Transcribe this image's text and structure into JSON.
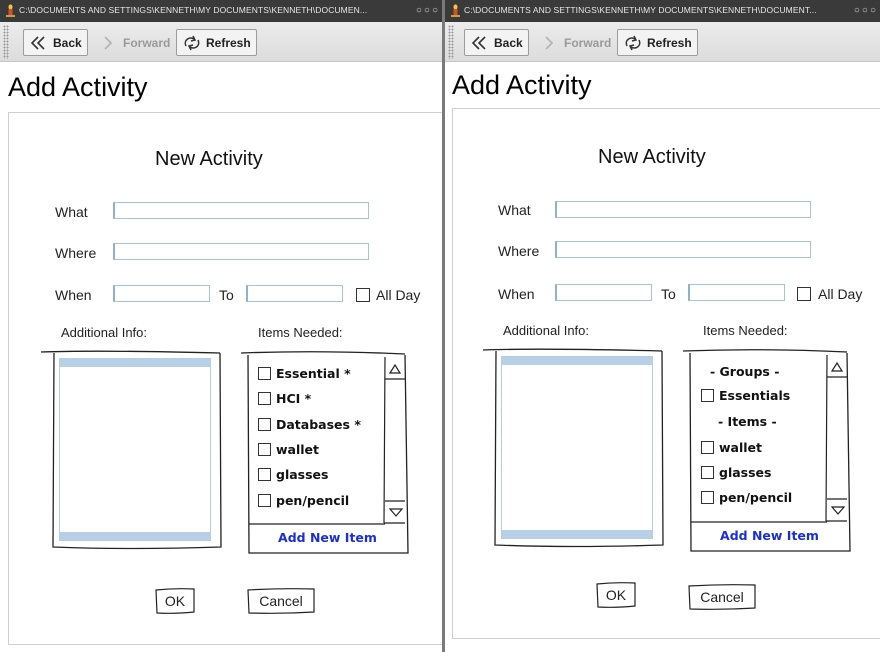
{
  "left": {
    "window_title": "C:\\DOCUMENTS AND SETTINGS\\KENNETH\\MY DOCUMENTS\\KENNETH\\DOCUMEN...",
    "toolbar": {
      "back_label": "Back",
      "forward_label": "Forward",
      "refresh_label": "Refresh"
    },
    "page_title": "Add Activity",
    "form": {
      "title": "New Activity",
      "what_label": "What",
      "what_value": "",
      "where_label": "Where",
      "where_value": "",
      "when_label": "When",
      "when_value": "",
      "to_label": "To",
      "to_value": "",
      "all_day_label": "All Day",
      "all_day_checked": false,
      "additional_info_label": "Additional Info:",
      "items_needed_label": "Items Needed:",
      "items": [
        {
          "label": "Essential *",
          "checked": false
        },
        {
          "label": "HCI *",
          "checked": false
        },
        {
          "label": "Databases *",
          "checked": false
        },
        {
          "label": "wallet",
          "checked": false
        },
        {
          "label": "glasses",
          "checked": false
        },
        {
          "label": "pen/pencil",
          "checked": false
        }
      ],
      "add_new_item_label": "Add New Item",
      "ok_label": "OK",
      "cancel_label": "Cancel"
    }
  },
  "right": {
    "window_title": "C:\\DOCUMENTS AND SETTINGS\\KENNETH\\MY DOCUMENTS\\KENNETH\\DOCUMENT...",
    "toolbar": {
      "back_label": "Back",
      "forward_label": "Forward",
      "refresh_label": "Refresh"
    },
    "page_title": "Add Activity",
    "form": {
      "title": "New Activity",
      "what_label": "What",
      "what_value": "",
      "where_label": "Where",
      "where_value": "",
      "when_label": "When",
      "when_value": "",
      "to_label": "To",
      "to_value": "",
      "all_day_label": "All Day",
      "all_day_checked": false,
      "additional_info_label": "Additional Info:",
      "items_needed_label": "Items Needed:",
      "groups_header": "- Groups -",
      "groups": [
        {
          "label": "Essentials",
          "checked": false
        }
      ],
      "items_header": "- Items -",
      "items": [
        {
          "label": "wallet",
          "checked": false
        },
        {
          "label": "glasses",
          "checked": false
        },
        {
          "label": "pen/pencil",
          "checked": false
        }
      ],
      "add_new_item_label": "Add New Item",
      "ok_label": "OK",
      "cancel_label": "Cancel"
    }
  },
  "colors": {
    "titlebar": "#3a3a3a",
    "field_border": "#a9c3dc",
    "textarea_highlight": "#b7cfe7",
    "link_blue": "#1a2fd6"
  },
  "icons": {
    "window": "candle-app-icon",
    "back": "double-chevron-left-icon",
    "forward": "chevron-right-icon",
    "refresh": "refresh-arrows-icon",
    "scroll_up": "triangle-up-icon",
    "scroll_down": "triangle-down-icon"
  }
}
